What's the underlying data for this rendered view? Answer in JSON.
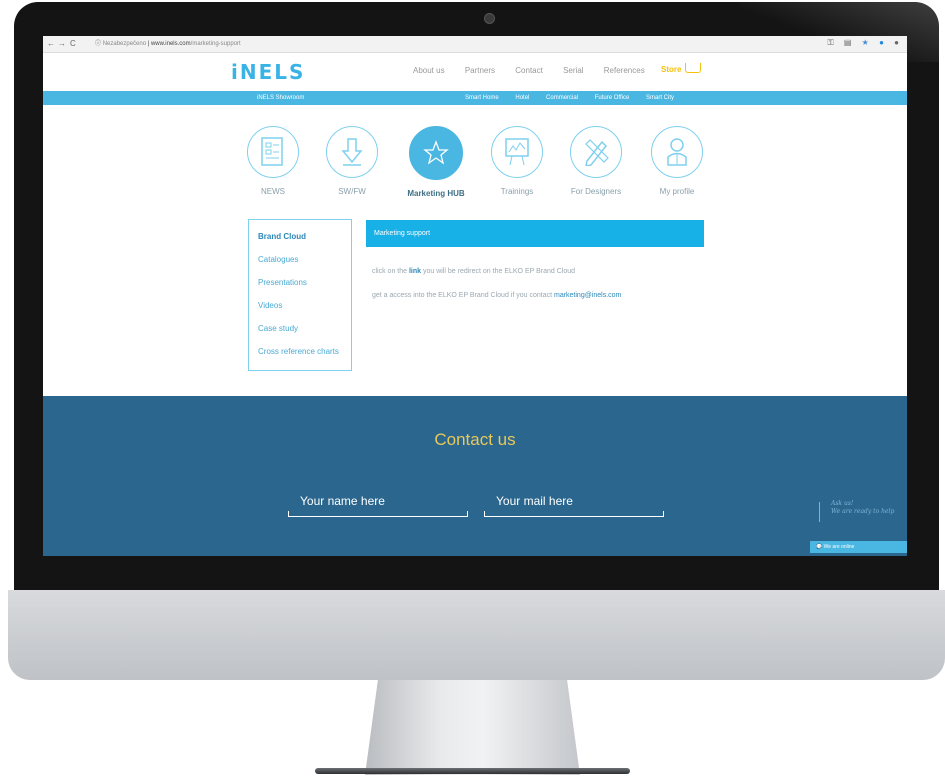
{
  "browser": {
    "back": "←",
    "forward": "→",
    "reload": "C",
    "security": "Nezabezpečeno",
    "domain": "www.inels.com",
    "path": "/marketing-support"
  },
  "header": {
    "logo": "iNELS",
    "nav": [
      "About us",
      "Partners",
      "Contact",
      "Serial",
      "References"
    ],
    "store": "Store"
  },
  "subnav": {
    "showroom": "iNELS Showroom",
    "items": [
      "Smart Home",
      "Hotel",
      "Commercial",
      "Future Office",
      "Smart City"
    ]
  },
  "hub": {
    "items": [
      {
        "label": "NEWS",
        "icon": "news-icon"
      },
      {
        "label": "SW/FW",
        "icon": "download-icon"
      },
      {
        "label": "Marketing HUB",
        "icon": "star-icon"
      },
      {
        "label": "Trainings",
        "icon": "chart-board-icon"
      },
      {
        "label": "For Designers",
        "icon": "pencil-ruler-icon"
      },
      {
        "label": "My profile",
        "icon": "user-icon"
      }
    ],
    "active_index": 2
  },
  "side_menu": {
    "items": [
      "Brand Cloud",
      "Catalogues",
      "Presentations",
      "Videos",
      "Case study",
      "Cross reference charts"
    ]
  },
  "content": {
    "heading": "Marketing support",
    "line1_pre": "click on the",
    "line1_link": "link",
    "line1_post": "you will be redirect on the ELKO EP Brand Cloud",
    "line2_pre": "get a access into the ELKO EP Brand Cloud if you contact",
    "line2_email": "marketing@inels.com"
  },
  "contact": {
    "title": "Contact us",
    "name_placeholder": "Your name here",
    "mail_placeholder": "Your mail here"
  },
  "chat": {
    "ask": "Ask us!",
    "ready": "We are ready to help",
    "status": "We are online"
  },
  "colors": {
    "accent": "#4ab6e2",
    "footer": "#2a668e",
    "store": "#f4c20d"
  }
}
